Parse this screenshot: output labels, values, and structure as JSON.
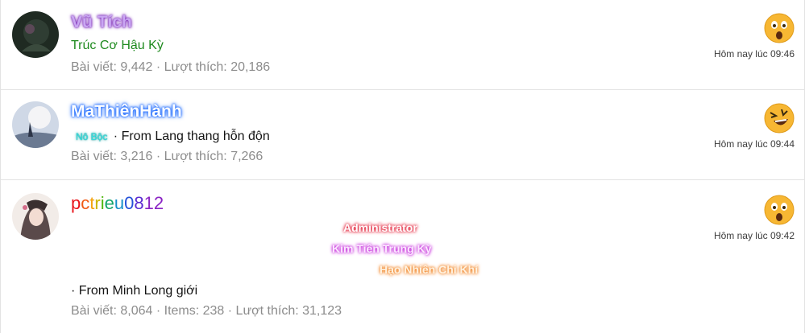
{
  "reactions": [
    {
      "username": "Vũ Tích",
      "title": "Trúc Cơ Hậu Kỳ",
      "stats": "Bài viết: 9,442 · Lượt thích: 20,186",
      "reaction_icon": "wow-face-icon",
      "time": "Hôm nay lúc 09:46"
    },
    {
      "username": "MaThiênHành",
      "badge": "Nô Bộc",
      "title": " · From Lang thang hỗn độn",
      "stats": "Bài viết: 3,216 · Lượt thích: 7,266",
      "reaction_icon": "laughing-face-icon",
      "time": "Hôm nay lúc 09:44"
    },
    {
      "username_chars": [
        "p",
        "c",
        "t",
        "r",
        "i",
        "e",
        "u",
        "0",
        "8",
        "1",
        "2"
      ],
      "ranks": [
        "Administrator",
        "Kim Tiên Trung Kỳ",
        "Hạo Nhiên Chi Khí"
      ],
      "title": "· From Minh Long giới",
      "stats": "Bài viết: 8,064 · Items: 238 · Lượt thích: 31,123",
      "reaction_icon": "wow-face-icon",
      "time": "Hôm nay lúc 09:42"
    }
  ],
  "colors": {
    "user1_glow": "#6a0dad",
    "user1_title": "#1e8a1e",
    "user2_glow": "#1e6bff",
    "badge": "#36e0e0",
    "stats": "#8c8c8c",
    "emoji_yellow": "#f7b733"
  }
}
